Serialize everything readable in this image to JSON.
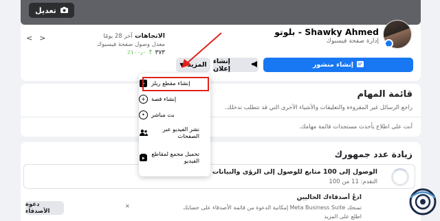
{
  "cover": {
    "edit_label": "تعديل"
  },
  "page": {
    "name": "Shawky Ahmed - بلوتو",
    "subtitle": "إدارة صفحة فيسبوك"
  },
  "insights": {
    "title": "الاتجاهات",
    "period": "آخر 28 يومًا",
    "subtitle": "معدل وصول صفحة فيسبوك",
    "value": "٣٧٣",
    "change": "١٠٠٫٠٪"
  },
  "actions": {
    "create_post": "إنشاء منشور",
    "create_ad": "إنشاء إعلان",
    "more": "المزيد"
  },
  "more_menu": {
    "items": [
      {
        "label": "إنشاء مقطع ريلز",
        "icon": "reel-icon"
      },
      {
        "label": "إنشاء قصة",
        "icon": "story-icon"
      },
      {
        "label": "بث مباشر",
        "icon": "live-icon"
      },
      {
        "label": "نشر الفيديو عبر الصفحات",
        "icon": "crosspost-icon"
      },
      {
        "label": "تحميل مجمع لمقاطع الفيديو",
        "icon": "bulk-upload-icon"
      }
    ]
  },
  "tasks": {
    "title": "قائمة المهام",
    "description": "راجع الرسائل غير المقروءة والتعليقات والأشياء الأخرى التي قد تتطلب تدخلك.",
    "empty": "أنت على اطلاع بأحدث مستجدات قائمة مهامك."
  },
  "growth": {
    "title": "زيادة عدد جمهورك",
    "goal_text": "الوصول إلى 100 متابع للوصول إلى الرؤى والبيانات الديموغرافية",
    "goal_progress": "التقدم: 11 من 100",
    "invite_title": "ادعُ أصدقاءك الحاليين",
    "invite_desc": "تمنحك Meta Business Suite إمكانية الدعوة من قائمة الأصدقاء على حسابك",
    "invite_link": "اطلع على المزيد",
    "invite_button": "دعوة الأصدقاء"
  },
  "colors": {
    "primary": "#1877f2",
    "highlight": "#e0201a"
  }
}
